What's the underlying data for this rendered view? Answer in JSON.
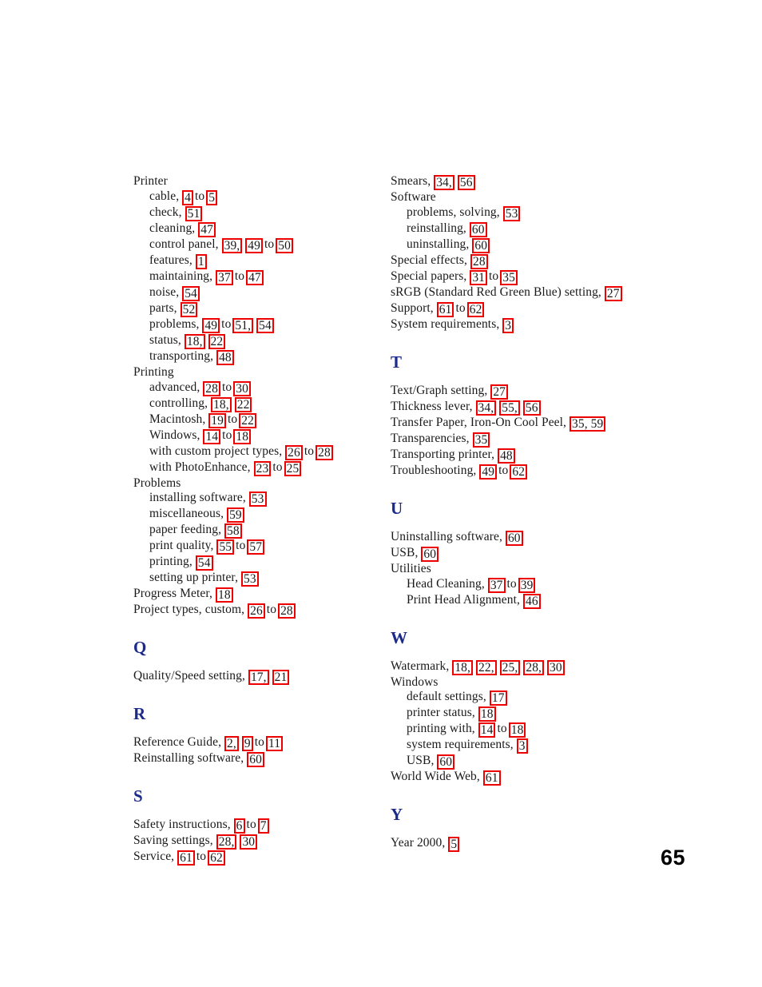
{
  "document": {
    "type": "index",
    "folio": "65",
    "ref_box_color": "#ee0000",
    "section_letter_color": "#1c2a8a",
    "text_color": "#1a1a1a"
  },
  "left_column": [
    {
      "kind": "entry",
      "level": 1,
      "label": "Printer",
      "refs": []
    },
    {
      "kind": "entry",
      "level": 2,
      "label": "cable,",
      "refs": [
        "4"
      ],
      "joiner": "to",
      "refs2": [
        "5"
      ]
    },
    {
      "kind": "entry",
      "level": 2,
      "label": "check,",
      "refs": [
        "51"
      ]
    },
    {
      "kind": "entry",
      "level": 2,
      "label": "cleaning,",
      "refs": [
        "47"
      ]
    },
    {
      "kind": "entry",
      "level": 2,
      "label": "control panel,",
      "refs": [
        "39,",
        "49"
      ],
      "joiner": "to",
      "refs2": [
        "50"
      ]
    },
    {
      "kind": "entry",
      "level": 2,
      "label": "features,",
      "refs": [
        "1"
      ]
    },
    {
      "kind": "entry",
      "level": 2,
      "label": "maintaining,",
      "refs": [
        "37"
      ],
      "joiner": "to",
      "refs2": [
        "47"
      ]
    },
    {
      "kind": "entry",
      "level": 2,
      "label": "noise,",
      "refs": [
        "54"
      ]
    },
    {
      "kind": "entry",
      "level": 2,
      "label": "parts,",
      "refs": [
        "52"
      ]
    },
    {
      "kind": "entry",
      "level": 2,
      "label": "problems,",
      "refs": [
        "49"
      ],
      "joiner": "to",
      "refs2": [
        "51,",
        "54"
      ]
    },
    {
      "kind": "entry",
      "level": 2,
      "label": "status,",
      "refs": [
        "18,",
        "22"
      ]
    },
    {
      "kind": "entry",
      "level": 2,
      "label": "transporting,",
      "refs": [
        "48"
      ]
    },
    {
      "kind": "entry",
      "level": 1,
      "label": "Printing",
      "refs": []
    },
    {
      "kind": "entry",
      "level": 2,
      "label": "advanced,",
      "refs": [
        "28"
      ],
      "joiner": "to",
      "refs2": [
        "30"
      ]
    },
    {
      "kind": "entry",
      "level": 2,
      "label": "controlling,",
      "refs": [
        "18,",
        "22"
      ]
    },
    {
      "kind": "entry",
      "level": 2,
      "label": "Macintosh,",
      "refs": [
        "19"
      ],
      "joiner": "to",
      "refs2": [
        "22"
      ]
    },
    {
      "kind": "entry",
      "level": 2,
      "label": "Windows,",
      "refs": [
        "14"
      ],
      "joiner": "to",
      "refs2": [
        "18"
      ]
    },
    {
      "kind": "entry",
      "level": 2,
      "label": "with custom project types,",
      "refs": [
        "26"
      ],
      "joiner": "to",
      "refs2": [
        "28"
      ]
    },
    {
      "kind": "entry",
      "level": 2,
      "label": "with PhotoEnhance,",
      "refs": [
        "23"
      ],
      "joiner": "to",
      "refs2": [
        "25"
      ]
    },
    {
      "kind": "entry",
      "level": 1,
      "label": "Problems",
      "refs": []
    },
    {
      "kind": "entry",
      "level": 2,
      "label": "installing software,",
      "refs": [
        "53"
      ]
    },
    {
      "kind": "entry",
      "level": 2,
      "label": "miscellaneous,",
      "refs": [
        "59"
      ]
    },
    {
      "kind": "entry",
      "level": 2,
      "label": "paper feeding,",
      "refs": [
        "58"
      ]
    },
    {
      "kind": "entry",
      "level": 2,
      "label": "print quality,",
      "refs": [
        "55"
      ],
      "joiner": "to",
      "refs2": [
        "57"
      ]
    },
    {
      "kind": "entry",
      "level": 2,
      "label": "printing,",
      "refs": [
        "54"
      ]
    },
    {
      "kind": "entry",
      "level": 2,
      "label": "setting up printer,",
      "refs": [
        "53"
      ]
    },
    {
      "kind": "entry",
      "level": 1,
      "label": "Progress Meter,",
      "refs": [
        "18"
      ]
    },
    {
      "kind": "entry",
      "level": 1,
      "label": "Project types, custom,",
      "refs": [
        "26"
      ],
      "joiner": "to",
      "refs2": [
        "28"
      ]
    },
    {
      "kind": "gap",
      "size": "sec"
    },
    {
      "kind": "letter",
      "label": "Q"
    },
    {
      "kind": "gap",
      "size": "hdr"
    },
    {
      "kind": "entry",
      "level": 1,
      "label": "Quality/Speed setting,",
      "refs": [
        "17,",
        "21"
      ]
    },
    {
      "kind": "gap",
      "size": "sec"
    },
    {
      "kind": "letter",
      "label": "R"
    },
    {
      "kind": "gap",
      "size": "hdr"
    },
    {
      "kind": "entry",
      "level": 1,
      "label": "Reference Guide,",
      "refs": [
        "2,",
        "9"
      ],
      "joiner": "to",
      "refs2": [
        "11"
      ]
    },
    {
      "kind": "entry",
      "level": 1,
      "label": "Reinstalling software,",
      "refs": [
        "60"
      ]
    },
    {
      "kind": "gap",
      "size": "sec"
    },
    {
      "kind": "letter",
      "label": "S"
    },
    {
      "kind": "gap",
      "size": "hdr"
    },
    {
      "kind": "entry",
      "level": 1,
      "label": "Safety instructions,",
      "refs": [
        "6"
      ],
      "joiner": "to",
      "refs2": [
        "7"
      ]
    },
    {
      "kind": "entry",
      "level": 1,
      "label": "Saving settings,",
      "refs": [
        "28,",
        "30"
      ]
    },
    {
      "kind": "entry",
      "level": 1,
      "label": "Service,",
      "refs": [
        "61"
      ],
      "joiner": "to",
      "refs2": [
        "62"
      ]
    }
  ],
  "right_column": [
    {
      "kind": "entry",
      "level": 1,
      "label": "Smears,",
      "refs": [
        "34,",
        "56"
      ]
    },
    {
      "kind": "entry",
      "level": 1,
      "label": "Software",
      "refs": []
    },
    {
      "kind": "entry",
      "level": 2,
      "label": "problems, solving,",
      "refs": [
        "53"
      ]
    },
    {
      "kind": "entry",
      "level": 2,
      "label": "reinstalling,",
      "refs": [
        "60"
      ]
    },
    {
      "kind": "entry",
      "level": 2,
      "label": "uninstalling,",
      "refs": [
        "60"
      ]
    },
    {
      "kind": "entry",
      "level": 1,
      "label": "Special effects,",
      "refs": [
        "28"
      ]
    },
    {
      "kind": "entry",
      "level": 1,
      "label": "Special papers,",
      "refs": [
        "31"
      ],
      "joiner": "to",
      "refs2": [
        "35"
      ]
    },
    {
      "kind": "entry",
      "level": 1,
      "label": "sRGB (Standard Red Green Blue) setting,",
      "refs": [
        "27"
      ]
    },
    {
      "kind": "entry",
      "level": 1,
      "label": "Support,",
      "refs": [
        "61"
      ],
      "joiner": "to",
      "refs2": [
        "62"
      ]
    },
    {
      "kind": "entry",
      "level": 1,
      "label": "System requirements,",
      "refs": [
        "3"
      ]
    },
    {
      "kind": "gap",
      "size": "sec"
    },
    {
      "kind": "letter",
      "label": "T"
    },
    {
      "kind": "gap",
      "size": "hdr"
    },
    {
      "kind": "entry",
      "level": 1,
      "label": "Text/Graph setting,",
      "refs": [
        "27"
      ]
    },
    {
      "kind": "entry",
      "level": 1,
      "label": "Thickness lever,",
      "refs": [
        "34,",
        "55,",
        "56"
      ]
    },
    {
      "kind": "entry",
      "level": 1,
      "label": "Transfer Paper, Iron-On Cool Peel,",
      "refs": [
        "35, 59"
      ]
    },
    {
      "kind": "entry",
      "level": 1,
      "label": "Transparencies,",
      "refs": [
        "35"
      ]
    },
    {
      "kind": "entry",
      "level": 1,
      "label": "Transporting printer,",
      "refs": [
        "48"
      ]
    },
    {
      "kind": "entry",
      "level": 1,
      "label": "Troubleshooting,",
      "refs": [
        "49"
      ],
      "joiner": "to",
      "refs2": [
        "62"
      ]
    },
    {
      "kind": "gap",
      "size": "sec"
    },
    {
      "kind": "letter",
      "label": "U"
    },
    {
      "kind": "gap",
      "size": "hdr"
    },
    {
      "kind": "entry",
      "level": 1,
      "label": "Uninstalling software,",
      "refs": [
        "60"
      ]
    },
    {
      "kind": "entry",
      "level": 1,
      "label": "USB,",
      "refs": [
        "60"
      ]
    },
    {
      "kind": "entry",
      "level": 1,
      "label": "Utilities",
      "refs": []
    },
    {
      "kind": "entry",
      "level": 2,
      "label": "Head Cleaning,",
      "refs": [
        "37"
      ],
      "joiner": "to",
      "refs2": [
        "39"
      ]
    },
    {
      "kind": "entry",
      "level": 2,
      "label": "Print Head Alignment,",
      "refs": [
        "46"
      ]
    },
    {
      "kind": "gap",
      "size": "sec"
    },
    {
      "kind": "letter",
      "label": "W"
    },
    {
      "kind": "gap",
      "size": "hdr"
    },
    {
      "kind": "entry",
      "level": 1,
      "label": "Watermark,",
      "refs": [
        "18,",
        "22,",
        "25,",
        "28,",
        "30"
      ]
    },
    {
      "kind": "entry",
      "level": 1,
      "label": "Windows",
      "refs": []
    },
    {
      "kind": "entry",
      "level": 2,
      "label": "default settings,",
      "refs": [
        "17"
      ]
    },
    {
      "kind": "entry",
      "level": 2,
      "label": "printer status,",
      "refs": [
        "18"
      ]
    },
    {
      "kind": "entry",
      "level": 2,
      "label": "printing with,",
      "refs": [
        "14"
      ],
      "joiner": "to",
      "refs2": [
        "18"
      ]
    },
    {
      "kind": "entry",
      "level": 2,
      "label": "system requirements,",
      "refs": [
        "3"
      ]
    },
    {
      "kind": "entry",
      "level": 2,
      "label": "USB,",
      "refs": [
        "60"
      ]
    },
    {
      "kind": "entry",
      "level": 1,
      "label": "World Wide Web,",
      "refs": [
        "61"
      ]
    },
    {
      "kind": "gap",
      "size": "sec"
    },
    {
      "kind": "letter",
      "label": "Y"
    },
    {
      "kind": "gap",
      "size": "hdr"
    },
    {
      "kind": "entry",
      "level": 1,
      "label": "Year 2000,",
      "refs": [
        "5"
      ]
    }
  ]
}
